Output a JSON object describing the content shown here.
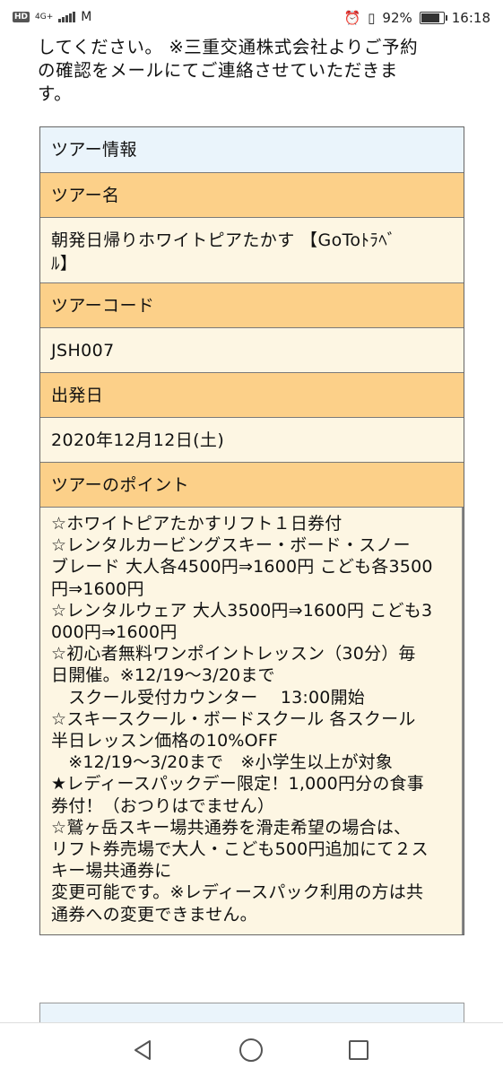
{
  "status_bar": {
    "hd": "HD",
    "network": "4G+",
    "mail_icon": "M",
    "battery_percent": "92%",
    "battery_level": 0.92,
    "time": "16:18"
  },
  "intro": {
    "lines": [
      "してください。 ※三重交通株式会社よりご予約",
      "の確認をメールにてご連絡させていただきま",
      "す。"
    ]
  },
  "table": {
    "header": "ツアー情報",
    "tour_name_label": "ツアー名",
    "tour_name_lines": [
      "朝発日帰りホワイトピアたかす 【GoToﾄﾗﾍﾞ",
      "ﾙ】"
    ],
    "tour_code_label": "ツアーコード",
    "tour_code": "JSH007",
    "departure_label": "出発日",
    "departure_date": "2020年12月12日(土)",
    "points_label": "ツアーのポイント",
    "points_lines": [
      "☆ホワイトピアたかすリフト１日券付",
      "☆レンタルカービングスキー・ボード・スノー",
      "ブレード 大人各4500円⇒1600円 こども各3500",
      "円⇒1600円",
      "☆レンタルウェア 大人3500円⇒1600円 こども3",
      "000円⇒1600円",
      "☆初心者無料ワンポイントレッスン（30分）毎",
      "日開催。※12/19～3/20まで",
      "　スクール受付カウンター　 13:00開始",
      "☆スキースクール・ボードスクール 各スクール",
      "半日レッスン価格の10%OFF",
      "　※12/19～3/20まで　※小学生以上が対象",
      "★レディースパックデー限定！1,000円分の食事",
      "券付！（おつりはでません）",
      "☆鷲ヶ岳スキー場共通券を滑走希望の場合は、",
      "リフト券売場で大人・こども500円追加にて２ス",
      "キー場共通券に",
      "変更可能です。※レディースパック利用の方は共",
      "通券への変更できません。"
    ]
  },
  "nav": {
    "back_icon": "back-triangle",
    "home_icon": "home-circle",
    "recent_icon": "recent-square"
  }
}
